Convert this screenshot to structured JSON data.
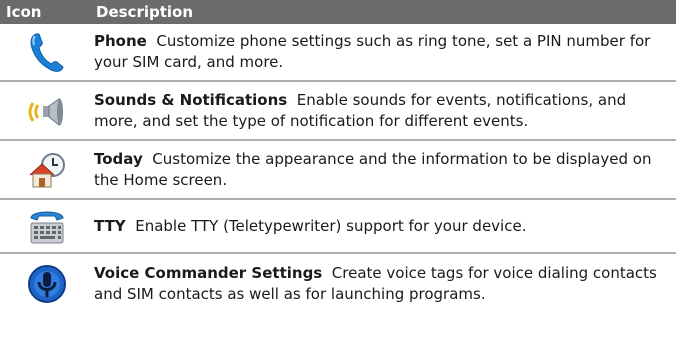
{
  "header": {
    "icon_label": "Icon",
    "description_label": "Description"
  },
  "rows": [
    {
      "icon": "phone-icon",
      "title": "Phone",
      "text": "Customize phone settings such as ring tone, set a PIN number for your SIM card, and more."
    },
    {
      "icon": "speaker-icon",
      "title": "Sounds & Notifications",
      "text": "Enable sounds for events, notifications, and more, and set the type of notification for different events."
    },
    {
      "icon": "home-clock-icon",
      "title": "Today",
      "text": "Customize the appearance and the information to be displayed on the Home screen."
    },
    {
      "icon": "tty-keyboard-icon",
      "title": "TTY",
      "text": "Enable TTY (Teletypewriter) support for your device."
    },
    {
      "icon": "microphone-icon",
      "title": "Voice Commander Settings",
      "text": "Create voice tags for voice dialing contacts and SIM contacts as well as for launching programs."
    }
  ]
}
